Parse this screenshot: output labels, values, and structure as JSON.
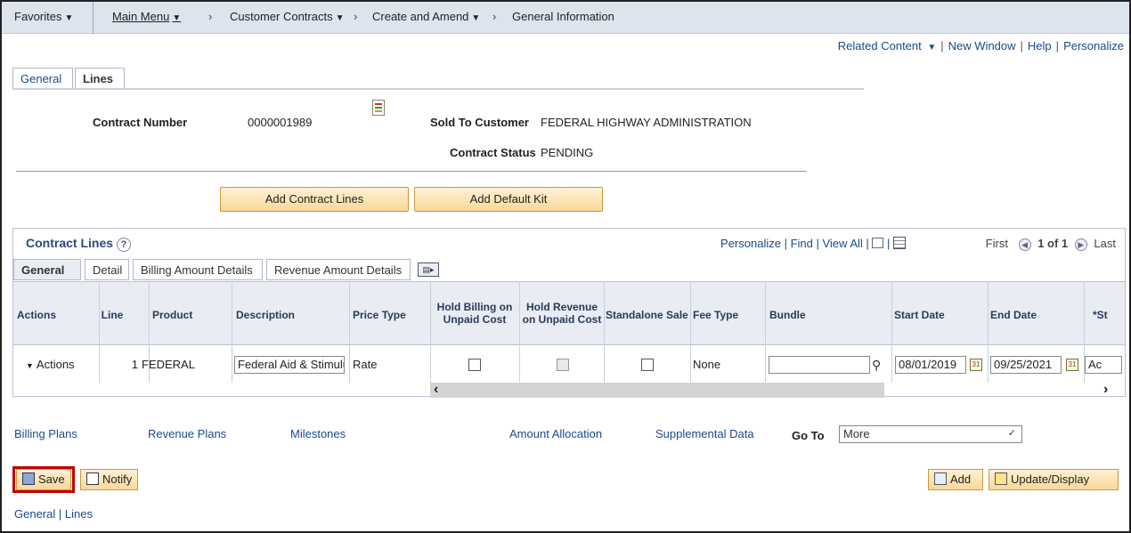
{
  "nav": {
    "favorites": "Favorites",
    "main_menu": "Main Menu",
    "customer_contracts": "Customer Contracts",
    "create_amend": "Create and Amend",
    "general_info": "General Information"
  },
  "related": {
    "related_content": "Related Content",
    "new_window": "New Window",
    "help": "Help",
    "personalize": "Personalize"
  },
  "tabs": {
    "general": "General",
    "lines": "Lines"
  },
  "header": {
    "contract_number_label": "Contract Number",
    "contract_number": "0000001989",
    "sold_to_label": "Sold To Customer",
    "sold_to": "FEDERAL HIGHWAY ADMINISTRATION",
    "status_label": "Contract Status",
    "status": "PENDING"
  },
  "buttons": {
    "add_lines": "Add Contract Lines",
    "add_kit": "Add Default Kit"
  },
  "grid": {
    "title": "Contract Lines",
    "personalize": "Personalize",
    "find": "Find",
    "view_all": "View All",
    "first": "First",
    "count": "1 of 1",
    "last": "Last",
    "subtabs": [
      "General",
      "Detail",
      "Billing Amount Details",
      "Revenue Amount Details"
    ],
    "columns": {
      "actions": "Actions",
      "line": "Line",
      "product": "Product",
      "description": "Description",
      "price_type": "Price Type",
      "hold_billing": "Hold Billing on Unpaid Cost",
      "hold_revenue": "Hold Revenue on Unpaid Cost",
      "standalone": "Standalone Sale",
      "fee_type": "Fee Type",
      "bundle": "Bundle",
      "start_date": "Start Date",
      "end_date": "End Date",
      "status": "*St"
    },
    "row": {
      "actions": "Actions",
      "line": "1",
      "product": "FEDERAL",
      "description": "Federal Aid & Stimulus",
      "price_type": "Rate",
      "fee_type": "None",
      "bundle": "",
      "start_date": "08/01/2019",
      "end_date": "09/25/2021",
      "status": "Ac"
    }
  },
  "plans": {
    "billing": "Billing Plans",
    "revenue": "Revenue Plans",
    "milestones": "Milestones",
    "allocation": "Amount Allocation",
    "supplemental": "Supplemental Data",
    "goto_label": "Go To",
    "goto_value": "More"
  },
  "footer": {
    "save": "Save",
    "notify": "Notify",
    "add": "Add",
    "update": "Update/Display",
    "general": "General",
    "lines": "Lines"
  }
}
